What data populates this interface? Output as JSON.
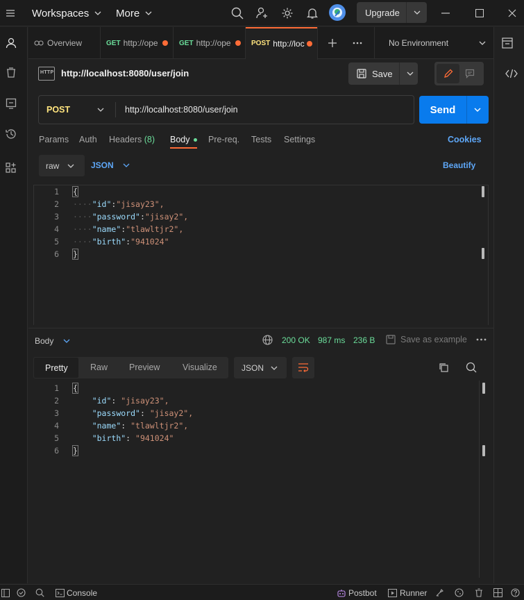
{
  "topbar": {
    "workspaces": "Workspaces",
    "more": "More",
    "upgrade": "Upgrade"
  },
  "tabs": [
    {
      "label": "Overview"
    },
    {
      "method": "GET",
      "label": "http://ope"
    },
    {
      "method": "GET",
      "label": "http://ope"
    },
    {
      "method": "POST",
      "label": "http://loc"
    }
  ],
  "environment": "No Environment",
  "request": {
    "title": "http://localhost:8080/user/join",
    "save_label": "Save",
    "method": "POST",
    "url": "http://localhost:8080/user/join",
    "send_label": "Send"
  },
  "request_tabs": {
    "params": "Params",
    "auth": "Auth",
    "headers": "Headers",
    "headers_count": "(8)",
    "body": "Body",
    "prereq": "Pre-req.",
    "tests": "Tests",
    "settings": "Settings",
    "cookies": "Cookies"
  },
  "body_options": {
    "mode": "raw",
    "format": "JSON",
    "beautify": "Beautify"
  },
  "request_body": {
    "line_numbers": [
      "1",
      "2",
      "3",
      "4",
      "5",
      "6"
    ],
    "brace_open": "{",
    "brace_close": "}",
    "fields": [
      {
        "key": "\"id\"",
        "value": "\"jisay23\","
      },
      {
        "key": "\"password\"",
        "value": "\"jisay2\","
      },
      {
        "key": "\"name\"",
        "value": "\"tlawltjr2\","
      },
      {
        "key": "\"birth\"",
        "value": "\"941024\""
      }
    ]
  },
  "response": {
    "section_label": "Body",
    "status": "200 OK",
    "time": "987 ms",
    "size": "236 B",
    "save_example": "Save as example",
    "view_tabs": [
      "Pretty",
      "Raw",
      "Preview",
      "Visualize"
    ],
    "format": "JSON"
  },
  "response_body": {
    "line_numbers": [
      "1",
      "2",
      "3",
      "4",
      "5",
      "6"
    ],
    "brace_open": "{",
    "brace_close": "}",
    "fields": [
      {
        "key": "\"id\"",
        "value": "\"jisay23\","
      },
      {
        "key": "\"password\"",
        "value": "\"jisay2\","
      },
      {
        "key": "\"name\"",
        "value": "\"tlawltjr2\","
      },
      {
        "key": "\"birth\"",
        "value": "\"941024\""
      }
    ]
  },
  "statusbar": {
    "console": "Console",
    "postbot": "Postbot",
    "runner": "Runner"
  },
  "colors": {
    "accent": "#ff6c37",
    "send": "#097bed",
    "link": "#5ea7f7",
    "success": "#6bdd9a"
  }
}
